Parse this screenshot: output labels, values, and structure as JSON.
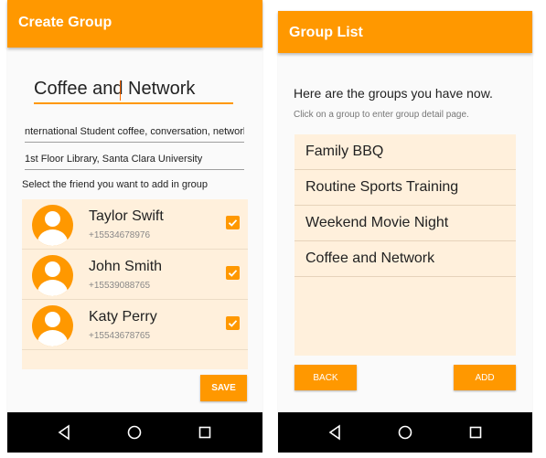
{
  "create_group": {
    "app_bar_title": "Create Group",
    "group_name_value": "Coffee and Network",
    "description_value": "nternational Student coffee, conversation, network",
    "location_value": "1st Floor Library, Santa Clara University",
    "instruction": "Select the friend you want to add in group",
    "friends": [
      {
        "name": "Taylor Swift",
        "phone": "+15534678976",
        "checked": true
      },
      {
        "name": "John Smith",
        "phone": "+15539088765",
        "checked": true
      },
      {
        "name": "Katy Perry",
        "phone": "+15543678765",
        "checked": true
      }
    ],
    "save_label": "SAVE"
  },
  "group_list": {
    "app_bar_title": "Group List",
    "heading": "Here are the groups you have now.",
    "subheading": "Click on a group to enter group detail page.",
    "groups": [
      "Family BBQ",
      "Routine Sports Training",
      "Weekend Movie Night",
      "Coffee and Network"
    ],
    "back_label": "BACK",
    "add_label": "ADD"
  },
  "nav_icons": [
    "back-triangle-icon",
    "home-circle-icon",
    "recents-square-icon"
  ],
  "colors": {
    "accent": "#ff9800",
    "list_background": "#fff0dc",
    "navbar": "#000000"
  }
}
